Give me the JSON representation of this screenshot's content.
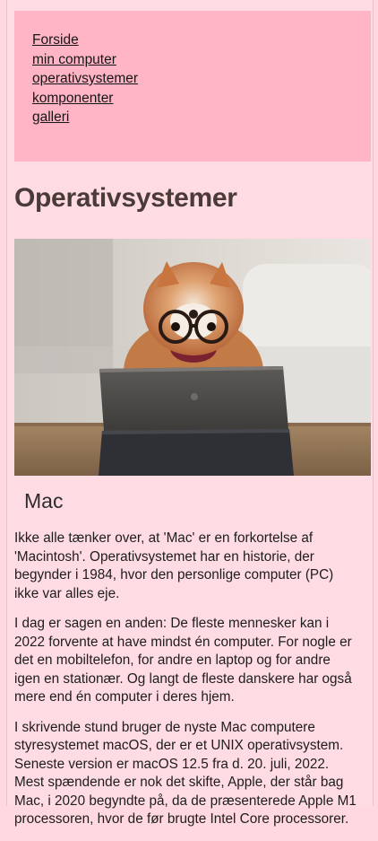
{
  "nav": {
    "items": [
      "Forside",
      "min computer",
      "operativsystemer",
      "komponenter",
      "galleri"
    ]
  },
  "page": {
    "title": "Operativsystemer"
  },
  "section": {
    "heading": "Mac",
    "paragraphs": [
      "Ikke alle tænker over, at 'Mac' er en forkortelse af 'Macintosh'. Operativsystemet har en historie, der begynder i 1984, hvor den personlige computer (PC) ikke var alles eje.",
      "I dag er sagen en anden: De fleste mennesker kan i 2022 forvente at have mindst én computer. For nogle er det en mobiltelefon, for andre en laptop og for andre igen en stationær. Og langt de fleste danskere har også mere end én computer i deres hjem.",
      "I skrivende stund bruger de nyste Mac computere styresystemet macOS, der er et UNIX operativsystem. Seneste version er macOS 12.5 fra d. 20. juli, 2022. Mest spændende er nok det skifte, Apple, der står bag Mac, i 2020 begyndte på, da de præsenterede Apple M1 processoren, hvor de før brugte Intel Core processorer."
    ]
  }
}
